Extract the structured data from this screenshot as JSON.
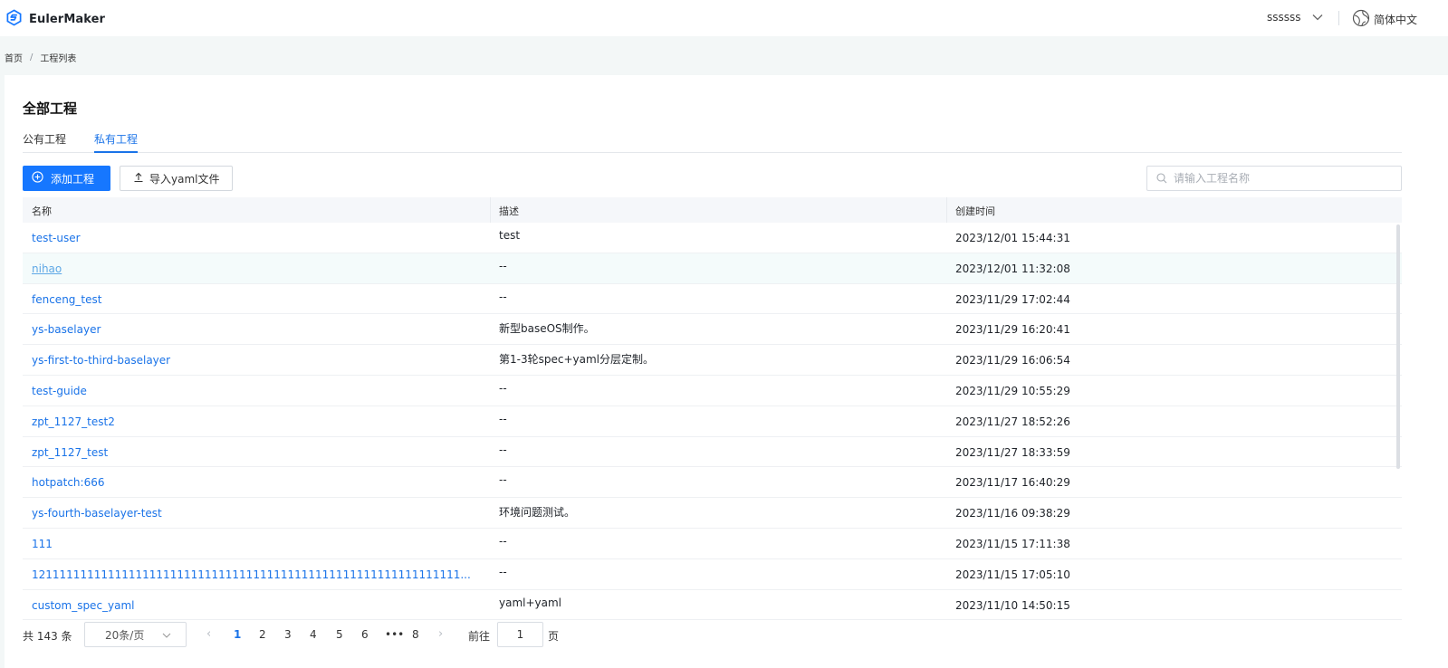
{
  "app": {
    "title": "EulerMaker",
    "user": "ssssss",
    "language": "简体中文"
  },
  "breadcrumb": {
    "home": "首页",
    "separator": "/",
    "current": "工程列表"
  },
  "page": {
    "title": "全部工程",
    "tabs": [
      {
        "label": "公有工程",
        "active": false
      },
      {
        "label": "私有工程",
        "active": true
      }
    ],
    "add_button": "添加工程",
    "import_button": "导入yaml文件",
    "search_placeholder": "请输入工程名称"
  },
  "table": {
    "columns": [
      "名称",
      "描述",
      "创建时间"
    ],
    "rows": [
      {
        "name": "test-user",
        "desc": "test",
        "time": "2023/12/01 15:44:31"
      },
      {
        "name": "nihao",
        "desc": "--",
        "time": "2023/12/01 11:32:08"
      },
      {
        "name": "fenceng_test",
        "desc": "--",
        "time": "2023/11/29 17:02:44"
      },
      {
        "name": "ys-baselayer",
        "desc": "新型baseOS制作。",
        "time": "2023/11/29 16:20:41"
      },
      {
        "name": "ys-first-to-third-baselayer",
        "desc": "第1-3轮spec+yaml分层定制。",
        "time": "2023/11/29 16:06:54"
      },
      {
        "name": "test-guide",
        "desc": "--",
        "time": "2023/11/29 10:55:29"
      },
      {
        "name": "zpt_1127_test2",
        "desc": "--",
        "time": "2023/11/27 18:52:26"
      },
      {
        "name": "zpt_1127_test",
        "desc": "--",
        "time": "2023/11/27 18:33:59"
      },
      {
        "name": "hotpatch:666",
        "desc": "--",
        "time": "2023/11/17 16:40:29"
      },
      {
        "name": "ys-fourth-baselayer-test",
        "desc": "环境问题测试。",
        "time": "2023/11/16 09:38:29"
      },
      {
        "name": "111",
        "desc": "--",
        "time": "2023/11/15 17:11:38"
      },
      {
        "name": "12111111111111111111111111111111111111111111111111111111111111...",
        "desc": "--",
        "time": "2023/11/15 17:05:10"
      },
      {
        "name": "custom_spec_yaml",
        "desc": "yaml+yaml",
        "time": "2023/11/10 14:50:15"
      }
    ]
  },
  "pagination": {
    "total": "共 143 条",
    "page_size": "20条/页",
    "pages": [
      "1",
      "2",
      "3",
      "4",
      "5",
      "6",
      "•••",
      "8"
    ],
    "current_page": "1",
    "goto_label": "前往",
    "goto_value": "1",
    "page_label": "页"
  },
  "colors": {
    "accent": "#1677ff",
    "link": "#1a73e8",
    "background": "#f3f7f7"
  }
}
